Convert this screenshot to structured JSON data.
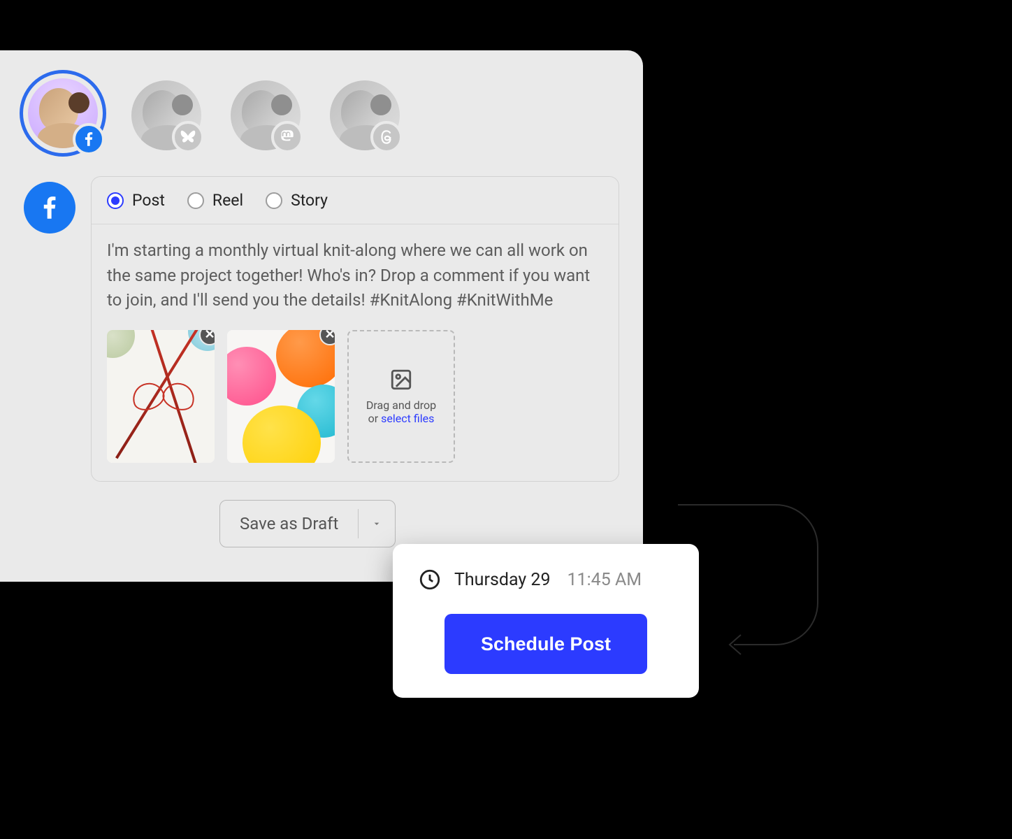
{
  "accounts": [
    {
      "network": "facebook",
      "selected": true
    },
    {
      "network": "bluesky",
      "selected": false
    },
    {
      "network": "mastodon",
      "selected": false
    },
    {
      "network": "threads",
      "selected": false
    }
  ],
  "post_types": {
    "options": [
      {
        "key": "post",
        "label": "Post",
        "checked": true
      },
      {
        "key": "reel",
        "label": "Reel",
        "checked": false
      },
      {
        "key": "story",
        "label": "Story",
        "checked": false
      }
    ]
  },
  "composer": {
    "text": "I'm starting a monthly virtual knit-along where we can all work on the same project together! Who's in? Drop a comment if you want to join, and I'll send you the details! #KnitAlong #KnitWithMe"
  },
  "media": {
    "attachments": [
      {
        "id": "img1",
        "alt": "knitting needles with red thread"
      },
      {
        "id": "img2",
        "alt": "colourful yarn balls"
      }
    ],
    "dropzone": {
      "line1": "Drag and drop",
      "line2_prefix": "or ",
      "line2_link": "select files"
    }
  },
  "footer": {
    "draft_label": "Save as Draft"
  },
  "schedule": {
    "date": "Thursday 29",
    "time": "11:45 AM",
    "button": "Schedule Post"
  }
}
